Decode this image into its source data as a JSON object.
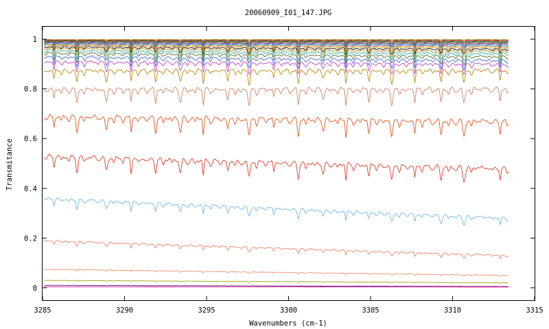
{
  "chart_data": {
    "type": "line",
    "title": "20060909_I01_147.JPG",
    "xlabel": "Wavenumbers (cm-1)",
    "ylabel": "Transmitance",
    "xlim": [
      3285,
      3315
    ],
    "ylim": [
      -0.05,
      1.05
    ],
    "x_data_range": [
      3285.1,
      3313.4
    ],
    "xticks": [
      3285,
      3290,
      3295,
      3300,
      3305,
      3310,
      3315
    ],
    "xtick_labels": [
      "3285",
      "3290",
      "3295",
      "3300",
      "3305",
      "3310",
      "3315"
    ],
    "yticks": [
      0,
      0.2,
      0.4,
      0.6,
      0.8,
      1
    ],
    "ytick_labels": [
      "0",
      "0.2",
      "0.4",
      "0.6",
      "0.8",
      "1"
    ],
    "grid": false,
    "legend": "none",
    "absorption_lines": [
      3285.7,
      3287.1,
      3288.9,
      3290.4,
      3291.9,
      3293.4,
      3294.8,
      3296.3,
      3297.6,
      3299.1,
      3300.6,
      3302.1,
      3303.5,
      3304.9,
      3306.3,
      3307.7,
      3309.3,
      3310.7,
      3312.9
    ],
    "series": [
      {
        "start": 0.998,
        "end": 0.998,
        "depth": 0.001,
        "color": "#808000"
      },
      {
        "start": 0.996,
        "end": 0.995,
        "depth": 0.004,
        "color": "#e00000"
      },
      {
        "start": 0.994,
        "end": 0.992,
        "depth": 0.006,
        "color": "#2e8b57"
      },
      {
        "start": 0.992,
        "end": 0.989,
        "depth": 0.008,
        "color": "#303030"
      },
      {
        "start": 0.99,
        "end": 0.986,
        "depth": 0.01,
        "color": "#87a020"
      },
      {
        "start": 0.987,
        "end": 0.982,
        "depth": 0.012,
        "color": "#8b008b"
      },
      {
        "start": 0.984,
        "end": 0.978,
        "depth": 0.014,
        "color": "#1e90ff"
      },
      {
        "start": 0.98,
        "end": 0.973,
        "depth": 0.017,
        "color": "#556b2f"
      },
      {
        "start": 0.976,
        "end": 0.967,
        "depth": 0.02,
        "color": "#ff8c00"
      },
      {
        "start": 0.97,
        "end": 0.96,
        "depth": 0.024,
        "color": "#000000"
      },
      {
        "start": 0.964,
        "end": 0.952,
        "depth": 0.028,
        "color": "#b8860b"
      },
      {
        "start": 0.955,
        "end": 0.942,
        "depth": 0.032,
        "color": "#20b2aa"
      },
      {
        "start": 0.945,
        "end": 0.93,
        "depth": 0.036,
        "color": "#556b2f"
      },
      {
        "start": 0.93,
        "end": 0.915,
        "depth": 0.04,
        "color": "#4169e1"
      },
      {
        "start": 0.91,
        "end": 0.9,
        "depth": 0.045,
        "color": "#c040c0"
      },
      {
        "start": 0.875,
        "end": 0.875,
        "depth": 0.055,
        "color": "#b8860b"
      },
      {
        "start": 0.8,
        "end": 0.8,
        "depth": 0.065,
        "color": "#cd8162"
      },
      {
        "start": 0.69,
        "end": 0.67,
        "depth": 0.07,
        "color": "#e0541c"
      },
      {
        "start": 0.53,
        "end": 0.48,
        "depth": 0.065,
        "color": "#dc3c2c"
      },
      {
        "start": 0.36,
        "end": 0.28,
        "depth": 0.04,
        "color": "#6eb6e6"
      },
      {
        "start": 0.19,
        "end": 0.13,
        "depth": 0.02,
        "color": "#f08060"
      },
      {
        "start": 0.075,
        "end": 0.05,
        "depth": 0.006,
        "color": "#ee8c6c"
      },
      {
        "start": 0.03,
        "end": 0.02,
        "depth": 0.002,
        "color": "#a0a000"
      },
      {
        "start": 0.01,
        "end": 0.005,
        "depth": 0.001,
        "color": "#4b0082"
      },
      {
        "start": 0.004,
        "end": 0.003,
        "depth": 0.0,
        "color": "#ff1493"
      }
    ]
  }
}
